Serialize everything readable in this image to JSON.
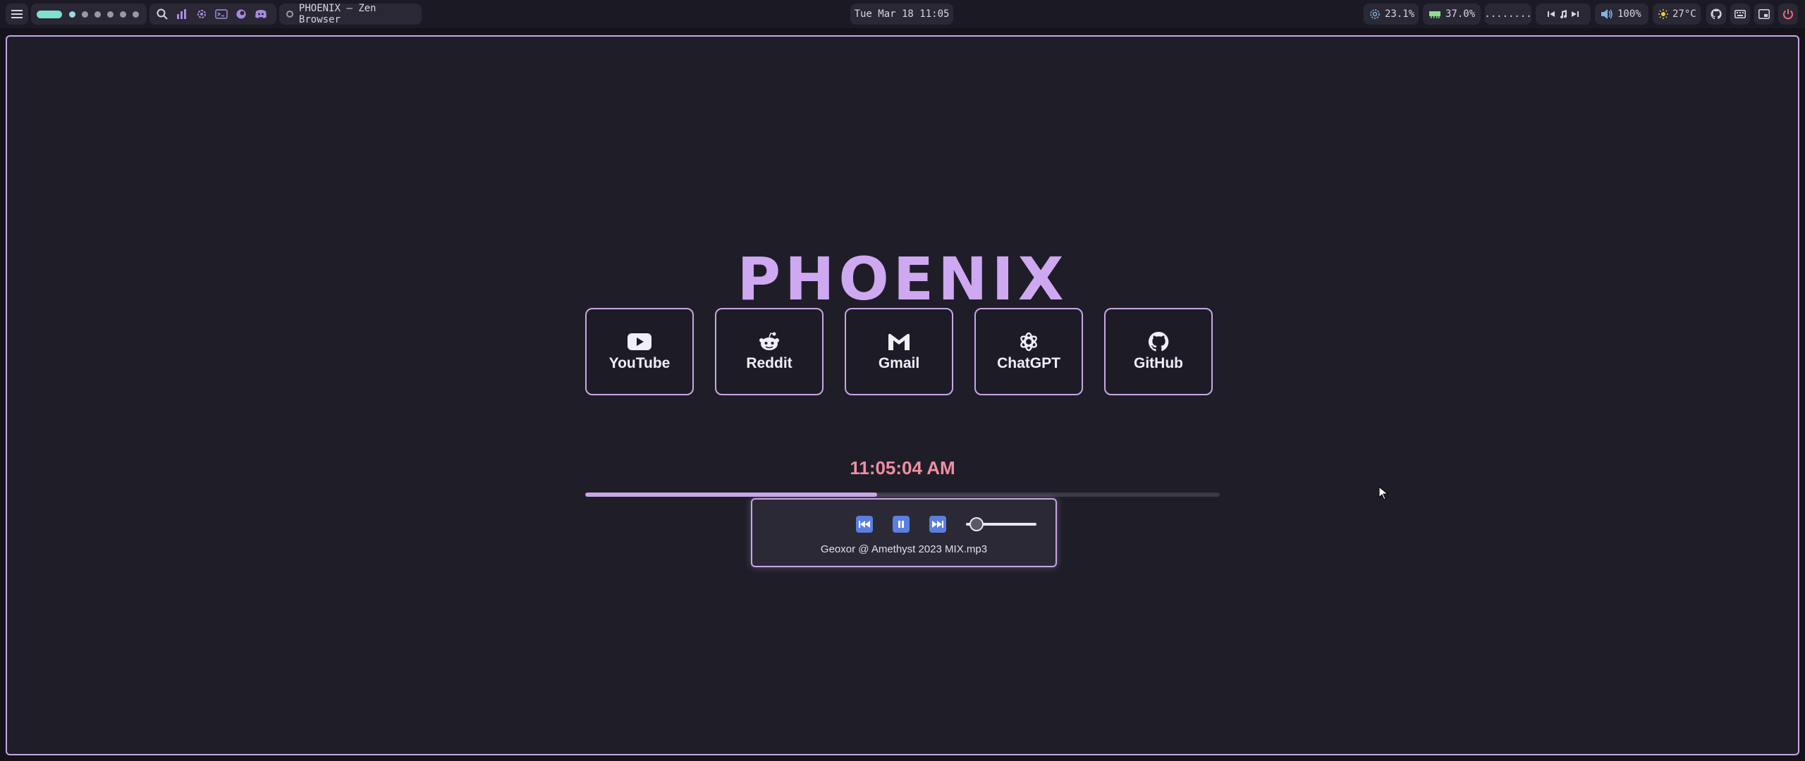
{
  "topbar": {
    "window_title": "PHOENIX — Zen Browser",
    "datetime": "Tue Mar 18 11:05",
    "cpu": "23.1%",
    "memory": "37.0%",
    "network": "........",
    "volume": "100%",
    "temperature": "27°C",
    "workspaces": [
      "1",
      "2",
      "3",
      "4",
      "5",
      "6",
      "7"
    ]
  },
  "page": {
    "title": "PHOENIX",
    "tiles": [
      {
        "label": "YouTube",
        "icon": "youtube-icon"
      },
      {
        "label": "Reddit",
        "icon": "reddit-icon"
      },
      {
        "label": "Gmail",
        "icon": "gmail-icon"
      },
      {
        "label": "ChatGPT",
        "icon": "chatgpt-icon"
      },
      {
        "label": "GitHub",
        "icon": "github-icon"
      }
    ],
    "clock": "11:05:04 AM",
    "progress": 0.46
  },
  "player": {
    "track": "Geoxor @ Amethyst 2023 MIX.mp3",
    "volume_level": 0.15
  },
  "colors": {
    "accent": "#c9a6e6",
    "clock": "#f08ea4",
    "workspace_active": "#7fe0d0",
    "button_blue": "#5b7fe0"
  }
}
